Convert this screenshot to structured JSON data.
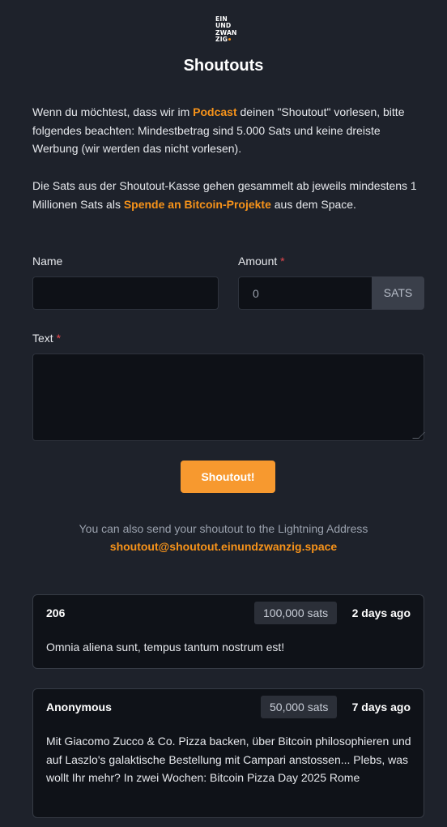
{
  "header": {
    "logo_lines": [
      "EIN",
      "UND",
      "ZWAN",
      "ZIG"
    ],
    "title": "Shoutouts"
  },
  "intro": {
    "p1_before": "Wenn du möchtest, dass wir im ",
    "p1_link": "Podcast",
    "p1_after": " deinen \"Shoutout\" vorlesen, bitte folgendes beachten: Mindestbetrag sind 5.000 Sats und keine dreiste Werbung (wir werden das nicht vorlesen).",
    "p2_before": "Die Sats aus der Shoutout-Kasse gehen gesammelt ab jeweils mindestens 1 Millionen Sats als ",
    "p2_link": "Spende an Bitcoin-Projekte",
    "p2_after": " aus dem Space."
  },
  "form": {
    "name_label": "Name",
    "name_value": "",
    "amount_label": "Amount",
    "amount_value": "0",
    "amount_unit": "SATS",
    "text_label": "Text",
    "text_value": "",
    "required_marker": "*",
    "submit_label": "Shoutout!"
  },
  "lightning": {
    "note": "You can also send your shoutout to the Lightning Address",
    "address": "shoutout@shoutout.einundzwanzig.space"
  },
  "shoutouts": [
    {
      "author": "206",
      "amount": "100,000 sats",
      "time": "2 days ago",
      "message": "Omnia aliena sunt, tempus tantum nostrum est!"
    },
    {
      "author": "Anonymous",
      "amount": "50,000 sats",
      "time": "7 days ago",
      "message": "Mit Giacomo Zucco & Co. Pizza backen, über Bitcoin philosophieren und auf Laszlo's galaktische Bestellung mit Campari anstossen... Plebs, was wollt Ihr mehr? In zwei Wochen: Bitcoin Pizza Day 2025 Rome"
    }
  ],
  "colors": {
    "accent": "#f7931a",
    "background": "#1e222b",
    "card_bg": "#0f1218",
    "required": "#e5484d"
  }
}
